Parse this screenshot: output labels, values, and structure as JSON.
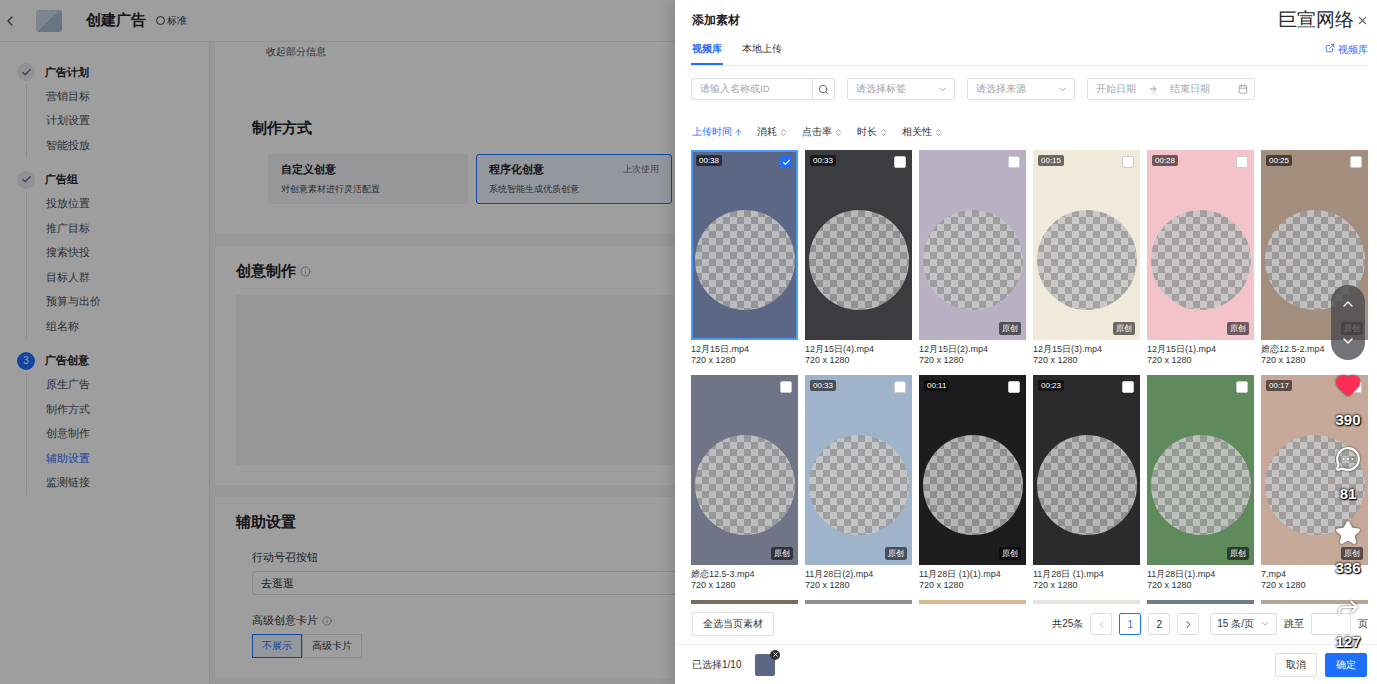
{
  "page": {
    "title": "创建广告",
    "badge": "标准",
    "steps": [
      {
        "number": "1",
        "label": "广告计划",
        "status": "done",
        "items": [
          {
            "label": "营销目标",
            "selected": false
          },
          {
            "label": "计划设置",
            "selected": false
          },
          {
            "label": "智能投放",
            "selected": false
          }
        ]
      },
      {
        "number": "2",
        "label": "广告组",
        "status": "done",
        "items": [
          {
            "label": "投放位置",
            "selected": false
          },
          {
            "label": "推广目标",
            "selected": false
          },
          {
            "label": "搜索快投",
            "selected": false
          },
          {
            "label": "目标人群",
            "selected": false
          },
          {
            "label": "预算与出价",
            "selected": false
          },
          {
            "label": "组名称",
            "selected": false
          }
        ]
      },
      {
        "number": "3",
        "label": "广告创意",
        "status": "active",
        "items": [
          {
            "label": "原生广告",
            "selected": false
          },
          {
            "label": "制作方式",
            "selected": false
          },
          {
            "label": "创意制作",
            "selected": false
          },
          {
            "label": "辅助设置",
            "selected": true
          },
          {
            "label": "监测链接",
            "selected": false
          }
        ]
      }
    ],
    "collapse_link": "收起部分信息",
    "production": {
      "title": "制作方式",
      "options": [
        {
          "title": "自定义创意",
          "desc": "对创意素材进行灵活配置",
          "tag": "",
          "selected": false
        },
        {
          "title": "程序化创意",
          "desc": "系统智能生成优质创意",
          "tag": "上次使用",
          "selected": true
        }
      ]
    },
    "creative": {
      "title": "创意制作"
    },
    "assist": {
      "title": "辅助设置",
      "cta_label": "行动号召按钮",
      "cta_value": "去逛逛",
      "card_label": "高级创意卡片",
      "card_options": [
        {
          "label": "不展示",
          "selected": true
        },
        {
          "label": "高级卡片",
          "selected": false
        }
      ]
    }
  },
  "drawer": {
    "title": "添加素材",
    "tabs": [
      {
        "label": "视频库",
        "selected": true
      },
      {
        "label": "本地上传",
        "selected": false
      }
    ],
    "library_link": "视频库",
    "search_placeholder": "请输入名称或ID",
    "tag_placeholder": "请选择标签",
    "source_placeholder": "请选择来源",
    "date_start": "开始日期",
    "date_end": "结束日期",
    "sort": [
      {
        "label": "上传时间",
        "selected": true
      },
      {
        "label": "消耗",
        "selected": false
      },
      {
        "label": "点击率",
        "selected": false
      },
      {
        "label": "时长",
        "selected": false
      },
      {
        "label": "相关性",
        "selected": false
      }
    ],
    "cards": [
      {
        "name": "12月15日.mp4",
        "resolution": "720 x 1280",
        "duration": "00:38",
        "badge": "",
        "checked": true,
        "selected": true,
        "color": "#5c6785"
      },
      {
        "name": "12月15日(4).mp4",
        "resolution": "720 x 1280",
        "duration": "00:33",
        "badge": "",
        "checked": false,
        "selected": false,
        "color": "#3b3c40"
      },
      {
        "name": "12月15日(2).mp4",
        "resolution": "720 x 1280",
        "duration": "",
        "badge": "原创",
        "checked": false,
        "selected": false,
        "color": "#b9b0c4"
      },
      {
        "name": "12月15日(3).mp4",
        "resolution": "720 x 1280",
        "duration": "00:15",
        "badge": "原创",
        "checked": false,
        "selected": false,
        "color": "#f1e9da"
      },
      {
        "name": "12月15日(1).mp4",
        "resolution": "720 x 1280",
        "duration": "00:28",
        "badge": "原创",
        "checked": false,
        "selected": false,
        "color": "#f3c3c9"
      },
      {
        "name": "嬗恋12.5-2.mp4",
        "resolution": "720 x 1280",
        "duration": "00:25",
        "badge": "原创",
        "checked": false,
        "selected": false,
        "color": "#a38d7c"
      },
      {
        "name": "嬗恋12.5-3.mp4",
        "resolution": "720 x 1280",
        "duration": "",
        "badge": "原创",
        "checked": false,
        "selected": false,
        "color": "#6f7486"
      },
      {
        "name": "11月28日(2).mp4",
        "resolution": "720 x 1280",
        "duration": "00:33",
        "badge": "原创",
        "checked": false,
        "selected": false,
        "color": "#9fb4cb"
      },
      {
        "name": "11月28日 (1)(1).mp4",
        "resolution": "720 x 1280",
        "duration": "00:11",
        "badge": "原创",
        "checked": false,
        "selected": false,
        "color": "#1d1d1f"
      },
      {
        "name": "11月28日 (1).mp4",
        "resolution": "720 x 1280",
        "duration": "00:23",
        "badge": "",
        "checked": false,
        "selected": false,
        "color": "#2b2a2c"
      },
      {
        "name": "11月28日(1).mp4",
        "resolution": "720 x 1280",
        "duration": "",
        "badge": "原创",
        "checked": false,
        "selected": false,
        "color": "#5f8a5c"
      },
      {
        "name": "7.mp4",
        "resolution": "720 x 1280",
        "duration": "00:17",
        "badge": "原创",
        "checked": false,
        "selected": false,
        "color": "#c5a898"
      }
    ],
    "partial_row": [
      {
        "color": "#7a6b60"
      },
      {
        "color": "#8a8f99"
      },
      {
        "color": "#d9b98a"
      },
      {
        "color": "#e8e4dc"
      },
      {
        "color": "#6d7a8c"
      },
      {
        "color": "#b7a596"
      }
    ],
    "select_all": "全选当页素材",
    "total": "共25条",
    "pages": [
      {
        "label": "1",
        "selected": true
      },
      {
        "label": "2",
        "selected": false
      }
    ],
    "page_size": "15 条/页",
    "jump_label": "跳至",
    "page_unit": "页",
    "selected_text": "已选择1/10",
    "cancel": "取消",
    "confirm": "确定"
  },
  "watermark": "巨宣网络",
  "video_overlay": {
    "stats": [
      {
        "kind": "like",
        "count": "390"
      },
      {
        "kind": "comment",
        "count": "81"
      },
      {
        "kind": "favorite",
        "count": "336"
      },
      {
        "kind": "share",
        "count": "127"
      }
    ]
  }
}
